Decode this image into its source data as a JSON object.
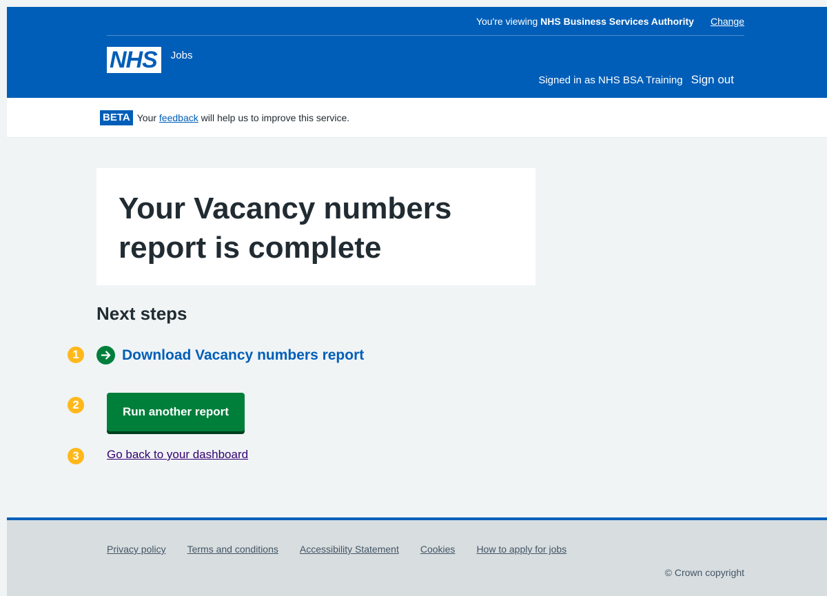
{
  "header": {
    "viewing_prefix": "You're viewing ",
    "organisation": "NHS Business Services Authority",
    "change_label": "Change",
    "logo_text": "NHS",
    "service_name": "Jobs",
    "signed_in_text": "Signed in as NHS BSA Training",
    "sign_out_label": "Sign out"
  },
  "beta_banner": {
    "tag": "BETA",
    "text_before": "Your ",
    "link_text": "feedback",
    "text_after": " will help us to improve this service."
  },
  "main": {
    "title": "Your Vacancy numbers report is complete",
    "next_steps_heading": "Next steps",
    "download_link": "Download Vacancy numbers report",
    "run_button": "Run another report",
    "dashboard_link": "Go back to your dashboard"
  },
  "annotations": [
    "1",
    "2",
    "3"
  ],
  "footer": {
    "links": [
      "Privacy policy",
      "Terms and conditions",
      "Accessibility Statement",
      "Cookies",
      "How to apply for jobs"
    ],
    "copyright": "© Crown copyright"
  },
  "colors": {
    "nhs_blue": "#005eb8",
    "green": "#007f3b",
    "annotation_yellow": "#ffb81c",
    "page_background": "#f0f4f5",
    "footer_background": "#d8dde0"
  }
}
